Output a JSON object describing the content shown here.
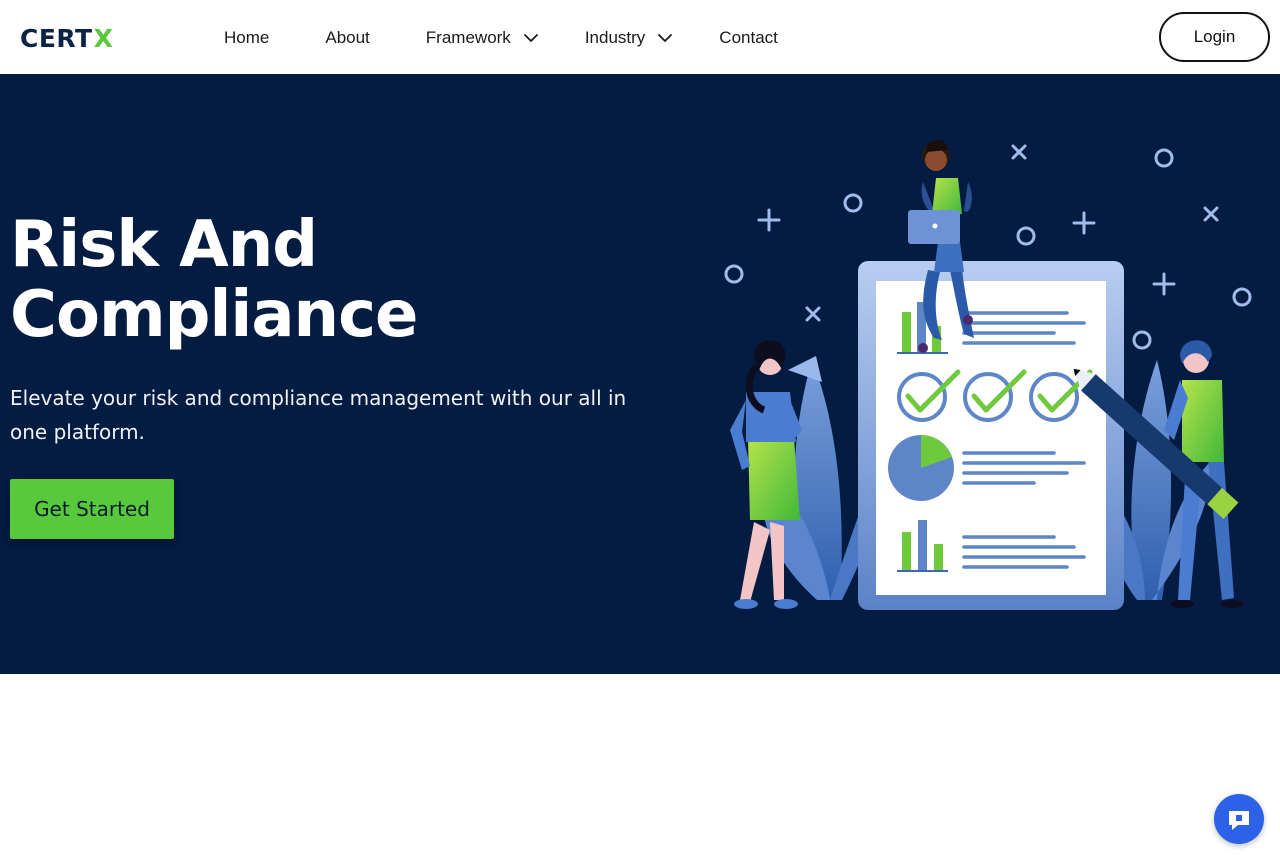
{
  "brand": {
    "logo_cert": "CERT",
    "logo_x": "X",
    "logo_name": "certx-logo"
  },
  "nav": {
    "home": "Home",
    "about": "About",
    "framework": "Framework",
    "industry": "Industry",
    "contact": "Contact"
  },
  "header": {
    "login_label": "Login"
  },
  "hero": {
    "title_line1": "Risk And",
    "title_line2": "Compliance",
    "subtitle": "Elevate your risk and compliance management with our all in one platform.",
    "cta_label": "Get Started"
  },
  "icons": {
    "framework_dropdown": "chevron-down-icon",
    "industry_dropdown": "chevron-down-icon",
    "chat": "chat-icon"
  },
  "colors": {
    "brand_navy": "#041c42",
    "brand_green": "#58c93a",
    "chat_blue": "#2b62e8"
  }
}
